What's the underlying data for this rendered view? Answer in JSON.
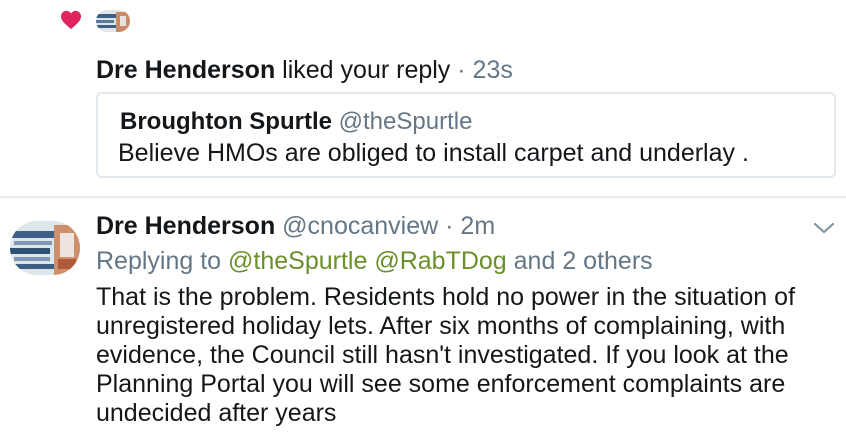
{
  "notification": {
    "actor_name": "Dre Henderson",
    "action": "liked your reply",
    "separator": "·",
    "time": "23s"
  },
  "quoted_tweet": {
    "author_name": "Broughton Spurtle",
    "author_handle": "@theSpurtle",
    "text": "Believe HMOs are obliged to install carpet and underlay ."
  },
  "tweet": {
    "author_name": "Dre Henderson",
    "author_handle": "@cnocanview",
    "separator": "·",
    "time": "2m",
    "replying_prefix": "Replying to",
    "mention_1": "@theSpurtle",
    "mention_2": "@RabTDog",
    "others": "and 2 others",
    "body": "That is the problem. Residents hold no power in the situation of unregistered holiday lets. After six months of complaining, with evidence, the Council still hasn't investigated. If you look at the Planning Portal you will see some enforcement complaints are undecided after years"
  },
  "colors": {
    "heart": "#e0245e",
    "secondary_text": "#657786",
    "mention": "#6b8f2a",
    "border": "#e1e8ed"
  },
  "icons": [
    "heart-icon",
    "chevron-down-icon"
  ]
}
